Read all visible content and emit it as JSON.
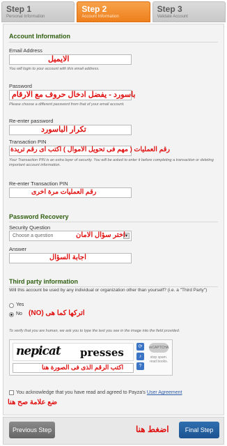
{
  "steps": [
    {
      "title": "Step 1",
      "subtitle": "Personal Information"
    },
    {
      "title": "Step 2",
      "subtitle": "Account Information"
    },
    {
      "title": "Step 3",
      "subtitle": "Validate Account"
    }
  ],
  "account": {
    "section_title": "Account Information",
    "email": {
      "label": "Email Address",
      "annotation": "الايميل",
      "help": "You will login to your account with this email address."
    },
    "password": {
      "label": "Password",
      "annotation": "باسورد - يفضل ادخال حروف مع الارقام",
      "help": "Please choose a different password from that of your email account."
    },
    "reenter_password": {
      "label": "Re-enter password",
      "annotation": "تكرار الباسورد"
    },
    "pin": {
      "label": "Transaction PIN",
      "annotation": "رقم العمليات ( مهم فى تحويل الاموال ) اكتب اى رقم تريدة",
      "help": "Your Transaction PIN is an extra layer of security. You will be asked to enter it before completing a transaction or deleting important account information."
    },
    "reenter_pin": {
      "label": "Re-enter Transaction PIN",
      "annotation": "رقم العمليات مرة اخرى"
    }
  },
  "recovery": {
    "section_title": "Password Recovery",
    "question_label": "Security Question",
    "question_selected": "Choose a question",
    "question_annotation": "اختر سؤال الامان",
    "answer_label": "Answer",
    "answer_annotation": "اجابة السؤال"
  },
  "third_party": {
    "section_title": "Third party information",
    "question": "Will this account be used by any individual or organization other than yourself? (i.e. a \"Third Party\")",
    "yes": "Yes",
    "no": "No",
    "annotation": "اتركها كما هى (NO)"
  },
  "captcha": {
    "instruction": "To verify that you are human, we ask you to type the text you see in the image into the field provided.",
    "word1": "nepicat",
    "word2": "presses",
    "annotation": "اكتب الرقم الذى فى الصورة هنا",
    "logo_text": "reCAPTCHA",
    "logo_tagline": "stop spam. read books."
  },
  "agreement": {
    "text": "You acknowledge that you have read and agreed to Payza's",
    "link": "User Agreement",
    "annotation": "ضع علامة صح هنا"
  },
  "footer": {
    "prev_label": "Previous Step",
    "final_label": "Final Step",
    "annotation": "اضغط هنا"
  },
  "colors": {
    "accent_orange": "#ee7f1c",
    "section_green": "#2f5f10",
    "annotation_red": "#e01010",
    "final_blue": "#1d5290"
  }
}
